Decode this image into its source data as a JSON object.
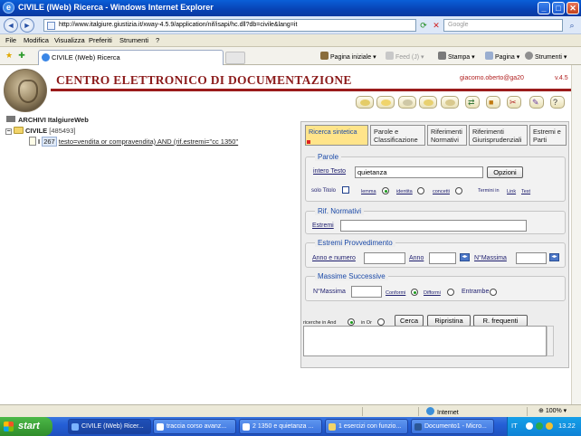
{
  "window": {
    "title": "CIVILE (IWeb) Ricerca - Windows Internet Explorer",
    "minimize_glyph": "_",
    "maximize_glyph": "□",
    "close_glyph": "✕"
  },
  "browser": {
    "back_glyph": "◄",
    "forward_glyph": "►",
    "url": "http://www.italgiure.giustizia.it/xway-4.5.9/application/nif/isapi/hc.dll?db=civile&lang=it",
    "search_placeholder": "Google",
    "menu": [
      "File",
      "Modifica",
      "Visualizza",
      "Preferiti",
      "Strumenti",
      "?"
    ],
    "tab_title": "CIVILE (IWeb) Ricerca",
    "commands": {
      "home": "Pagina iniziale",
      "feed": "Feed (J)",
      "print": "Stampa",
      "page": "Pagina",
      "tools": "Strumenti"
    },
    "status_zone": "Internet",
    "zoom": "100%"
  },
  "app": {
    "title": "CENTRO ELETTRONICO DI DOCUMENTAZIONE",
    "user": "giacomo.oberto@ga20",
    "version": "v.4.5"
  },
  "tree": {
    "root": "ARCHIVI ItalgiureWeb",
    "archive": "CIVILE",
    "archive_count": "[485493]",
    "query_prefix": "I",
    "query_count": "267",
    "query_text": "testo=vendita or compravendita) AND (rif.estremi=\"cc 1350\""
  },
  "form": {
    "tabs": [
      {
        "line1": "Ricerca sintetica",
        "line2": ""
      },
      {
        "line1": "Parole e",
        "line2": "Classificazione"
      },
      {
        "line1": "Riferimenti",
        "line2": "Normativi"
      },
      {
        "line1": "Riferimenti",
        "line2": "Giurisprudenziali"
      },
      {
        "line1": "Estremi e",
        "line2": "Parti"
      }
    ],
    "parole": {
      "legend": "Parole",
      "field_label": "intero Testo",
      "field_value": "quietanza",
      "options_button": "Opzioni",
      "solo_titolo": "solo Titolo",
      "lemma": "lemma",
      "identita": "identita",
      "concetti": "concetti",
      "termini_in": "Termini in",
      "link": "Link",
      "test": "Test"
    },
    "rif_normativi": {
      "legend": "Rif. Normativi",
      "estremi_label": "Estremi"
    },
    "estremi_provvedimento": {
      "legend": "Estremi Provvedimento",
      "anno_numero": "Anno e numero",
      "anno": "Anno",
      "nmassima": "N°Massima"
    },
    "massime_successive": {
      "legend": "Massime Successive",
      "nmassima": "N°Massima",
      "conformi": "Conformi",
      "difformi": "Difformi",
      "entrambe": "Entrambe"
    },
    "bottom": {
      "ricerche_in_and": "ricerche in And",
      "in_or": "in Or",
      "cerca": "Cerca",
      "ripristina": "Ripristina",
      "frequenti": "R. frequenti"
    }
  },
  "taskbar": {
    "start": "start",
    "tasks": [
      "CIVILE (IWeb) Ricer...",
      "traccia corso avanz...",
      "2 1350 e quietanza ...",
      "1 esercizi con funzio...",
      "Documento1 - Micro..."
    ],
    "lang": "IT",
    "clock": "13.22"
  },
  "colors": {
    "titlebar": "#0842b4",
    "app_title": "#8b1a1a",
    "active_tab": "#ffe48a",
    "legend_text": "#1b4aa8"
  }
}
